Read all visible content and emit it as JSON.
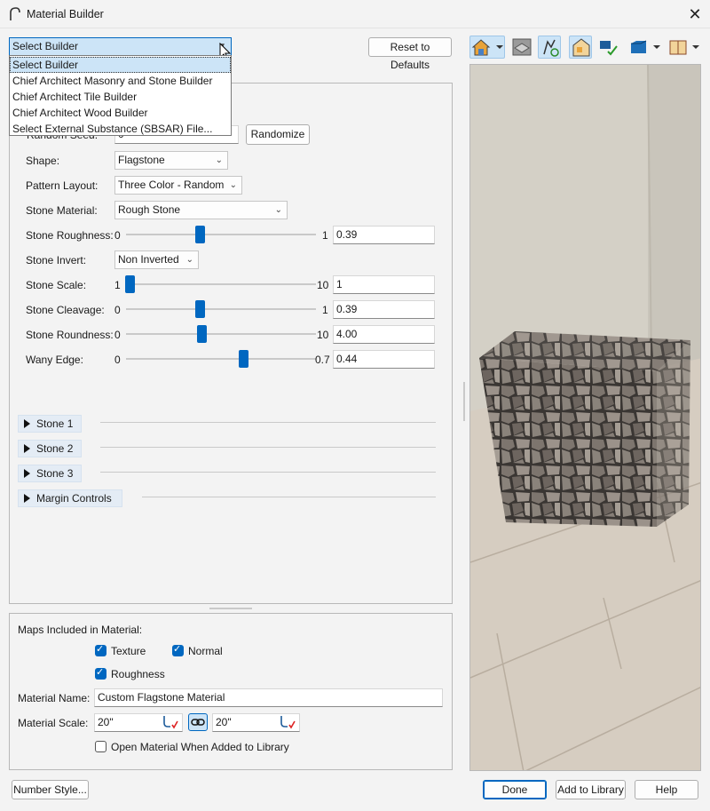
{
  "window": {
    "title": "Material Builder",
    "icon": "app-arch-icon",
    "close_icon": "close-icon",
    "close_glyph": "✕"
  },
  "builder_select": {
    "value": "Select Builder",
    "options": [
      "Select Builder",
      "Chief Architect Masonry and Stone Builder",
      "Chief Architect Tile Builder",
      "Chief Architect Wood Builder",
      "Select External Substance (SBSAR) File..."
    ]
  },
  "reset_label": "Reset to Defaults",
  "params": {
    "random_seed_label": "Random Seed:",
    "random_seed_value": "0",
    "randomize_label": "Randomize",
    "shape": {
      "label": "Shape:",
      "value": "Flagstone"
    },
    "pattern_layout": {
      "label": "Pattern Layout:",
      "value": "Three Color - Random"
    },
    "stone_material": {
      "label": "Stone Material:",
      "value": "Rough Stone"
    },
    "stone_invert": {
      "label": "Stone Invert:",
      "value": "Non Inverted"
    },
    "sliders": [
      {
        "label": "Stone Roughness:",
        "min": "0",
        "max": "1",
        "value": "0.39",
        "fraction": 0.39
      },
      {
        "label": "Stone Scale:",
        "min": "1",
        "max": "10",
        "value": "1",
        "fraction": 0.0
      },
      {
        "label": "Stone Cleavage:",
        "min": "0",
        "max": "1",
        "value": "0.39",
        "fraction": 0.39
      },
      {
        "label": "Stone Roundness:",
        "min": "0",
        "max": "10",
        "value": "4.00",
        "fraction": 0.4
      },
      {
        "label": "Wany Edge:",
        "min": "0",
        "max": "0.7",
        "value": "0.44",
        "fraction": 0.63
      }
    ],
    "groups": [
      "Stone 1",
      "Stone 2",
      "Stone 3",
      "Margin Controls"
    ]
  },
  "maps": {
    "heading": "Maps Included in Material:",
    "texture": {
      "label": "Texture",
      "checked": true
    },
    "normal": {
      "label": "Normal",
      "checked": true
    },
    "roughness": {
      "label": "Roughness",
      "checked": true
    }
  },
  "material_name": {
    "label": "Material Name:",
    "value": "Custom Flagstone Material"
  },
  "material_scale": {
    "label": "Material Scale:",
    "x": "20\"",
    "y": "20\""
  },
  "open_when_added": {
    "label": "Open Material When Added to Library",
    "checked": false
  },
  "footer": {
    "number_style": "Number Style...",
    "done": "Done",
    "add_to_library": "Add to Library",
    "help": "Help"
  },
  "toolbar_icons": [
    "house-view-icon",
    "layers-icon",
    "camera-refresh-icon",
    "floorplan-check-icon",
    "library-check-icon",
    "cube-icon",
    "box-view-icon"
  ],
  "colors": {
    "accent": "#0067c0",
    "selection": "#cce4f7"
  }
}
